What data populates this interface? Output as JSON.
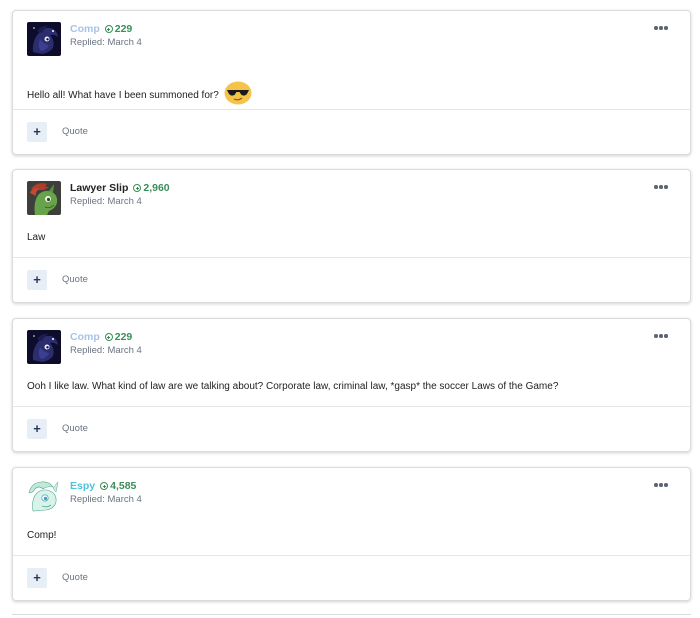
{
  "posts": [
    {
      "author": "Comp",
      "author_color": "#a8c2e6",
      "reputation": "229",
      "date": "Replied: March 4",
      "body": "Hello all! What have I been summoned for?",
      "avatar": "dark-pony-avatar",
      "has_emoji": true,
      "emoji": "sunglasses-emoji",
      "quote_label": "Quote",
      "plus_label": "+"
    },
    {
      "author": "Lawyer Slip",
      "author_color": "#222222",
      "reputation": "2,960",
      "date": "Replied: March 4",
      "body": "Law",
      "avatar": "green-pony-avatar",
      "quote_label": "Quote",
      "plus_label": "+"
    },
    {
      "author": "Comp",
      "author_color": "#a8c2e6",
      "reputation": "229",
      "date": "Replied: March 4",
      "body": "Ooh I like law. What kind of law are we talking about? Corporate law, criminal law, *gasp* the soccer Laws of the Game?",
      "avatar": "dark-pony-avatar",
      "quote_label": "Quote",
      "plus_label": "+"
    },
    {
      "author": "Espy",
      "author_color": "#4ec3dc",
      "reputation": "4,585",
      "date": "Replied: March 4",
      "body": "Comp!",
      "avatar": "mint-pony-avatar",
      "quote_label": "Quote",
      "plus_label": "+"
    }
  ],
  "colors": {
    "reputation": "#3a8e5a",
    "muted": "#6b7380",
    "button_bg": "#e8eef6"
  }
}
